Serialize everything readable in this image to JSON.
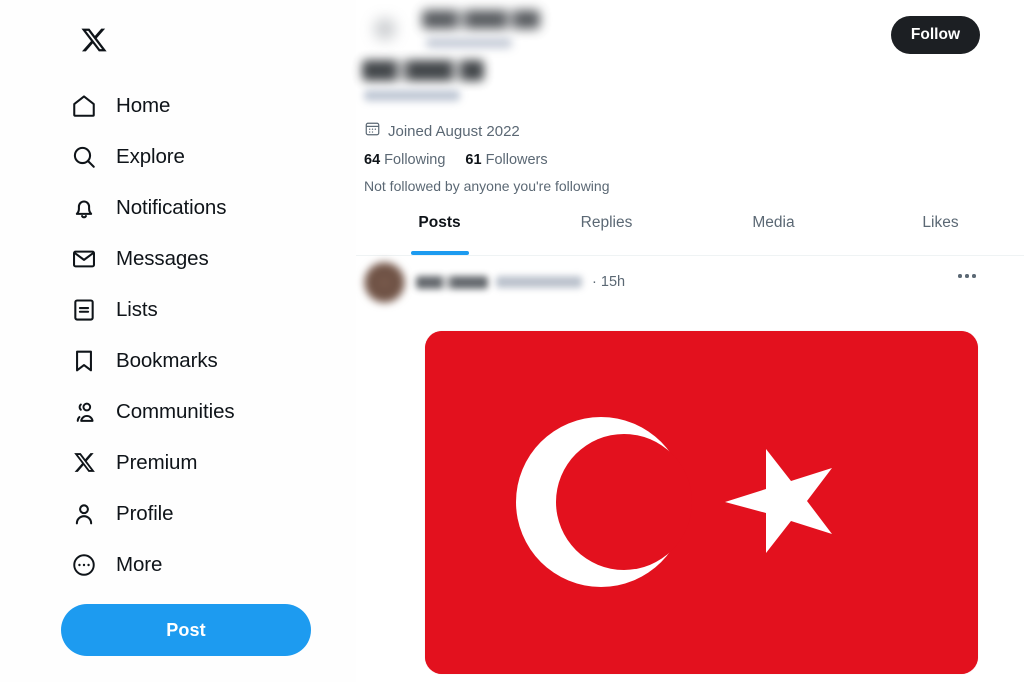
{
  "app": {
    "name": "X (Twitter)",
    "title": "Profile"
  },
  "colors": {
    "brand_blue": "#1D9BF0",
    "text_primary": "#0F1419",
    "text_secondary": "#5B6874",
    "follow_button_bg": "#1C1F23",
    "flag_red": "#E3111E",
    "flag_white": "#FFFFFF",
    "background": "#FFFFFF"
  },
  "sidebar": {
    "logo": {
      "icon": "x-logo-icon",
      "label": "X"
    },
    "items": [
      {
        "label": "Home",
        "icon": "home-icon"
      },
      {
        "label": "Explore",
        "icon": "search-icon"
      },
      {
        "label": "Notifications",
        "icon": "bell-icon"
      },
      {
        "label": "Messages",
        "icon": "envelope-icon"
      },
      {
        "label": "Lists",
        "icon": "list-icon"
      },
      {
        "label": "Bookmarks",
        "icon": "bookmark-icon"
      },
      {
        "label": "Communities",
        "icon": "people-icon"
      },
      {
        "label": "Premium",
        "icon": "x-logo-icon"
      },
      {
        "label": "Profile",
        "icon": "person-icon"
      },
      {
        "label": "More",
        "icon": "more-circle-icon"
      }
    ],
    "post_button": {
      "label": "Post"
    }
  },
  "profile": {
    "follow_button": {
      "label": "Follow"
    },
    "display_name": "",
    "handle": "",
    "joined": {
      "icon": "calendar-icon",
      "text": "Joined August 2022"
    },
    "following": {
      "count": "64",
      "label": "Following"
    },
    "followers": {
      "count": "61",
      "label": "Followers"
    },
    "not_followed_note": "Not followed by anyone you're following",
    "tabs": [
      {
        "label": "Posts",
        "active": true
      },
      {
        "label": "Replies",
        "active": false
      },
      {
        "label": "Media",
        "active": false
      },
      {
        "label": "Likes",
        "active": false
      }
    ]
  },
  "post": {
    "author_name": "",
    "author_handle": "",
    "separator": "·",
    "timestamp": "15h",
    "more_menu": {
      "icon": "more-horizontal-icon",
      "label": "More"
    },
    "media": {
      "name": "flag-of-turkey-image",
      "alt": "Flag of Turkey",
      "red": "#E3111E",
      "white": "#FFFFFF"
    }
  }
}
